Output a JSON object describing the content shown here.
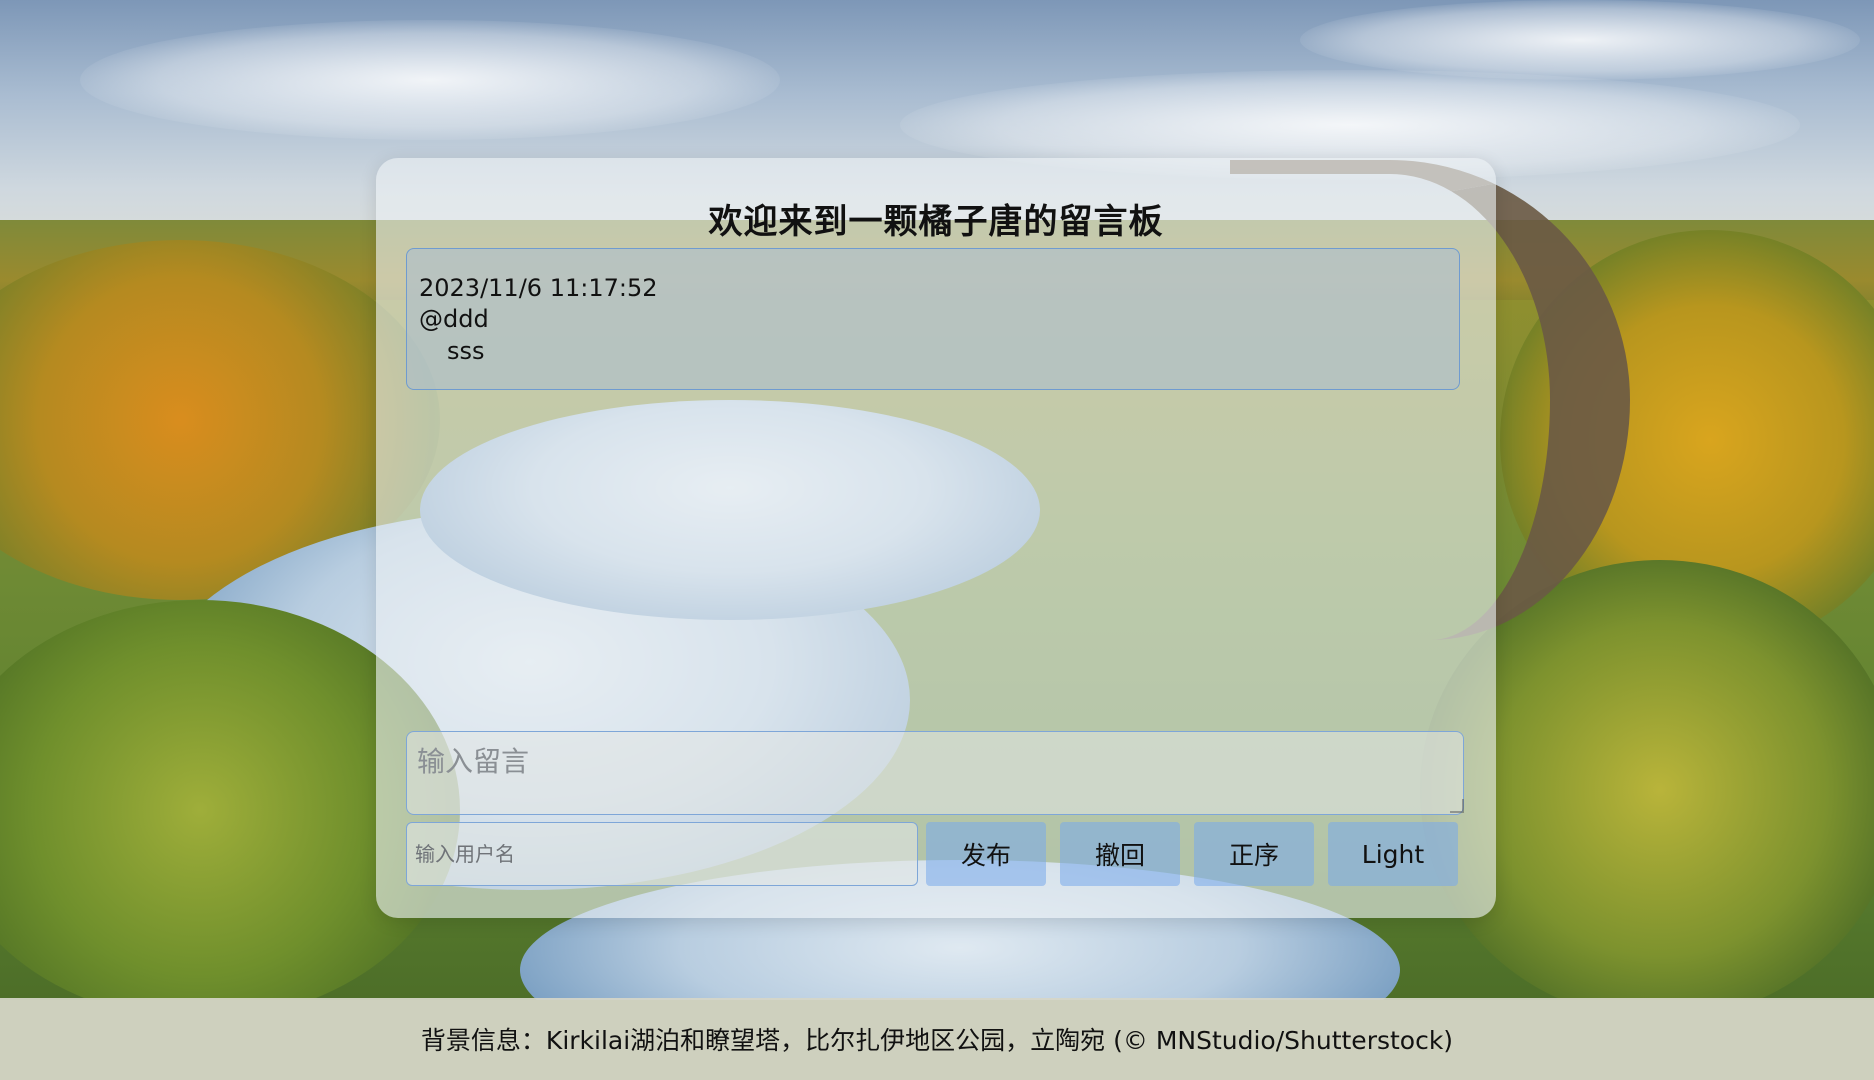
{
  "board": {
    "title": "欢迎来到一颗橘子唐的留言板"
  },
  "messages": [
    {
      "time": "2023/11/6 11:17:52",
      "user": "@ddd",
      "text": "sss"
    }
  ],
  "composer": {
    "message_placeholder": "输入留言",
    "username_placeholder": "输入用户名"
  },
  "buttons": {
    "publish": "发布",
    "withdraw": "撤回",
    "order": "正序",
    "theme": "Light"
  },
  "footer": {
    "background_info": "背景信息：Kirkilai湖泊和瞭望塔，比尔扎伊地区公园，立陶宛 (© MNStudio/Shutterstock)"
  },
  "colors": {
    "panel": "#ebf0f4",
    "button": "#78aaeb",
    "border": "#6f9bd0"
  }
}
